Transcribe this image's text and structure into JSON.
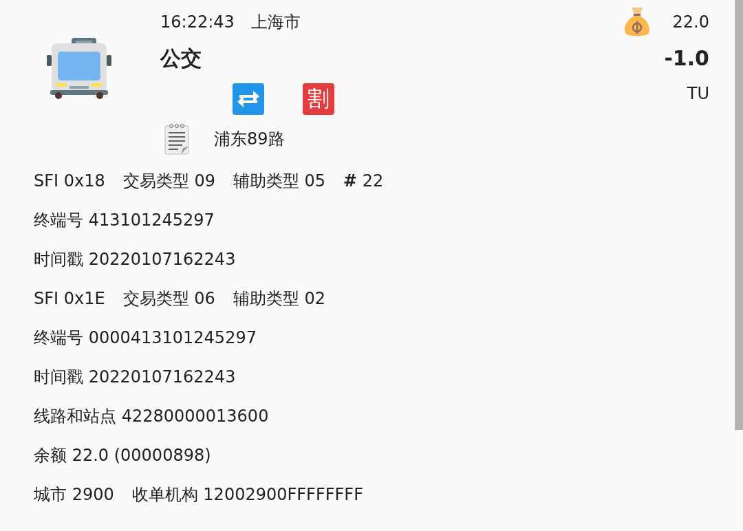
{
  "header": {
    "time": "16:22:43",
    "city": "上海市",
    "title": "公交",
    "route": "浦东89路",
    "discount_badge": "割",
    "balance": "22.0",
    "amount": "-1.0",
    "type_code": "TU"
  },
  "details": [
    {
      "parts": [
        "SFI 0x18",
        "交易类型 09",
        "辅助类型 05",
        "**#** 22"
      ]
    },
    {
      "parts": [
        "终端号 413101245297"
      ]
    },
    {
      "parts": [
        "时间戳 20220107162243"
      ]
    },
    {
      "parts": [
        "SFI 0x1E",
        "交易类型 06",
        "辅助类型 02"
      ]
    },
    {
      "parts": [
        "终端号 0000413101245297"
      ]
    },
    {
      "parts": [
        "时间戳 20220107162243"
      ]
    },
    {
      "parts": [
        "线路和站点 42280000013600"
      ]
    },
    {
      "parts": [
        "余额 22.0 (00000898)"
      ]
    },
    {
      "parts": [
        "城市 2900",
        "收单机构 12002900FFFFFFFF"
      ]
    }
  ]
}
